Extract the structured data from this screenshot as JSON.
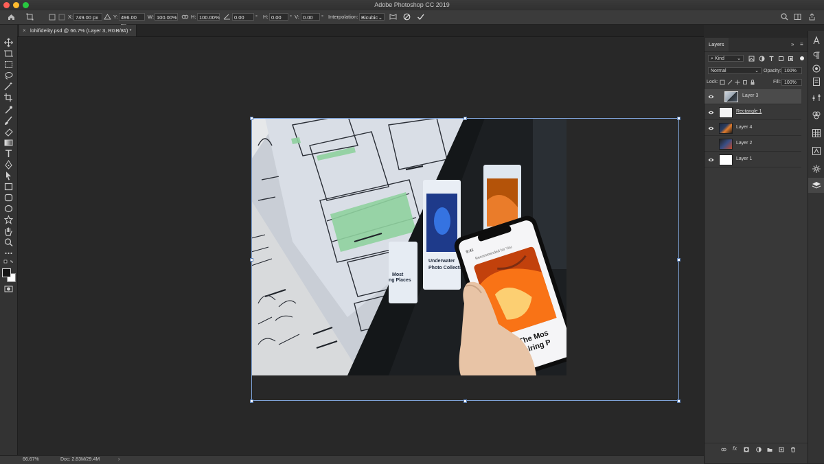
{
  "window": {
    "title": "Adobe Photoshop CC 2019"
  },
  "options": {
    "x_label": "X:",
    "x_value": "749.00 px",
    "y_label": "Y:",
    "y_value": "496.00 px",
    "w_label": "W:",
    "w_value": "100.00%",
    "h_label": "H:",
    "h_value": "100.00%",
    "angle_value": "0.00",
    "hskew_label": "H:",
    "hskew_value": "0.00",
    "vskew_label": "V:",
    "vskew_value": "0.00",
    "interp_label": "Interpolation:",
    "interp_value": "Bicubic",
    "degree_mark": "°"
  },
  "document": {
    "tab_title": "lohifidelity.psd @ 66.7% (Layer 3, RGB/8#) *",
    "close": "×"
  },
  "status": {
    "zoom": "66.67%",
    "doc": "Doc: 2.83M/29.4M",
    "arrow": "›"
  },
  "layers_panel": {
    "tab": "Layers",
    "filter": "Kind",
    "blend_mode": "Normal",
    "opacity_label": "Opacity:",
    "opacity_value": "100%",
    "lock_label": "Lock:",
    "fill_label": "Fill:",
    "fill_value": "100%",
    "layers": [
      {
        "name": "Layer 3",
        "visible": true,
        "selected": true
      },
      {
        "name": "Rectangle 1",
        "visible": true,
        "selected": false
      },
      {
        "name": "Layer 4",
        "visible": true,
        "selected": false
      },
      {
        "name": "Layer 2",
        "visible": false,
        "selected": false
      },
      {
        "name": "Layer 1",
        "visible": true,
        "selected": false
      }
    ]
  },
  "artwork": {
    "phone_time": "9:41",
    "phone_header": "Recommended for You",
    "phone_headline_1": "The Mos",
    "phone_headline_2": "nspiring P",
    "card1_line1": "Underwater",
    "card1_line2": "Photo Collection",
    "card2_line1": "Most",
    "card2_line2": "ng Places"
  },
  "colors": {
    "accent_bbox": "#7fa3d8",
    "selected_row": "#4b4b4b",
    "canvas_bg": "#282828"
  }
}
